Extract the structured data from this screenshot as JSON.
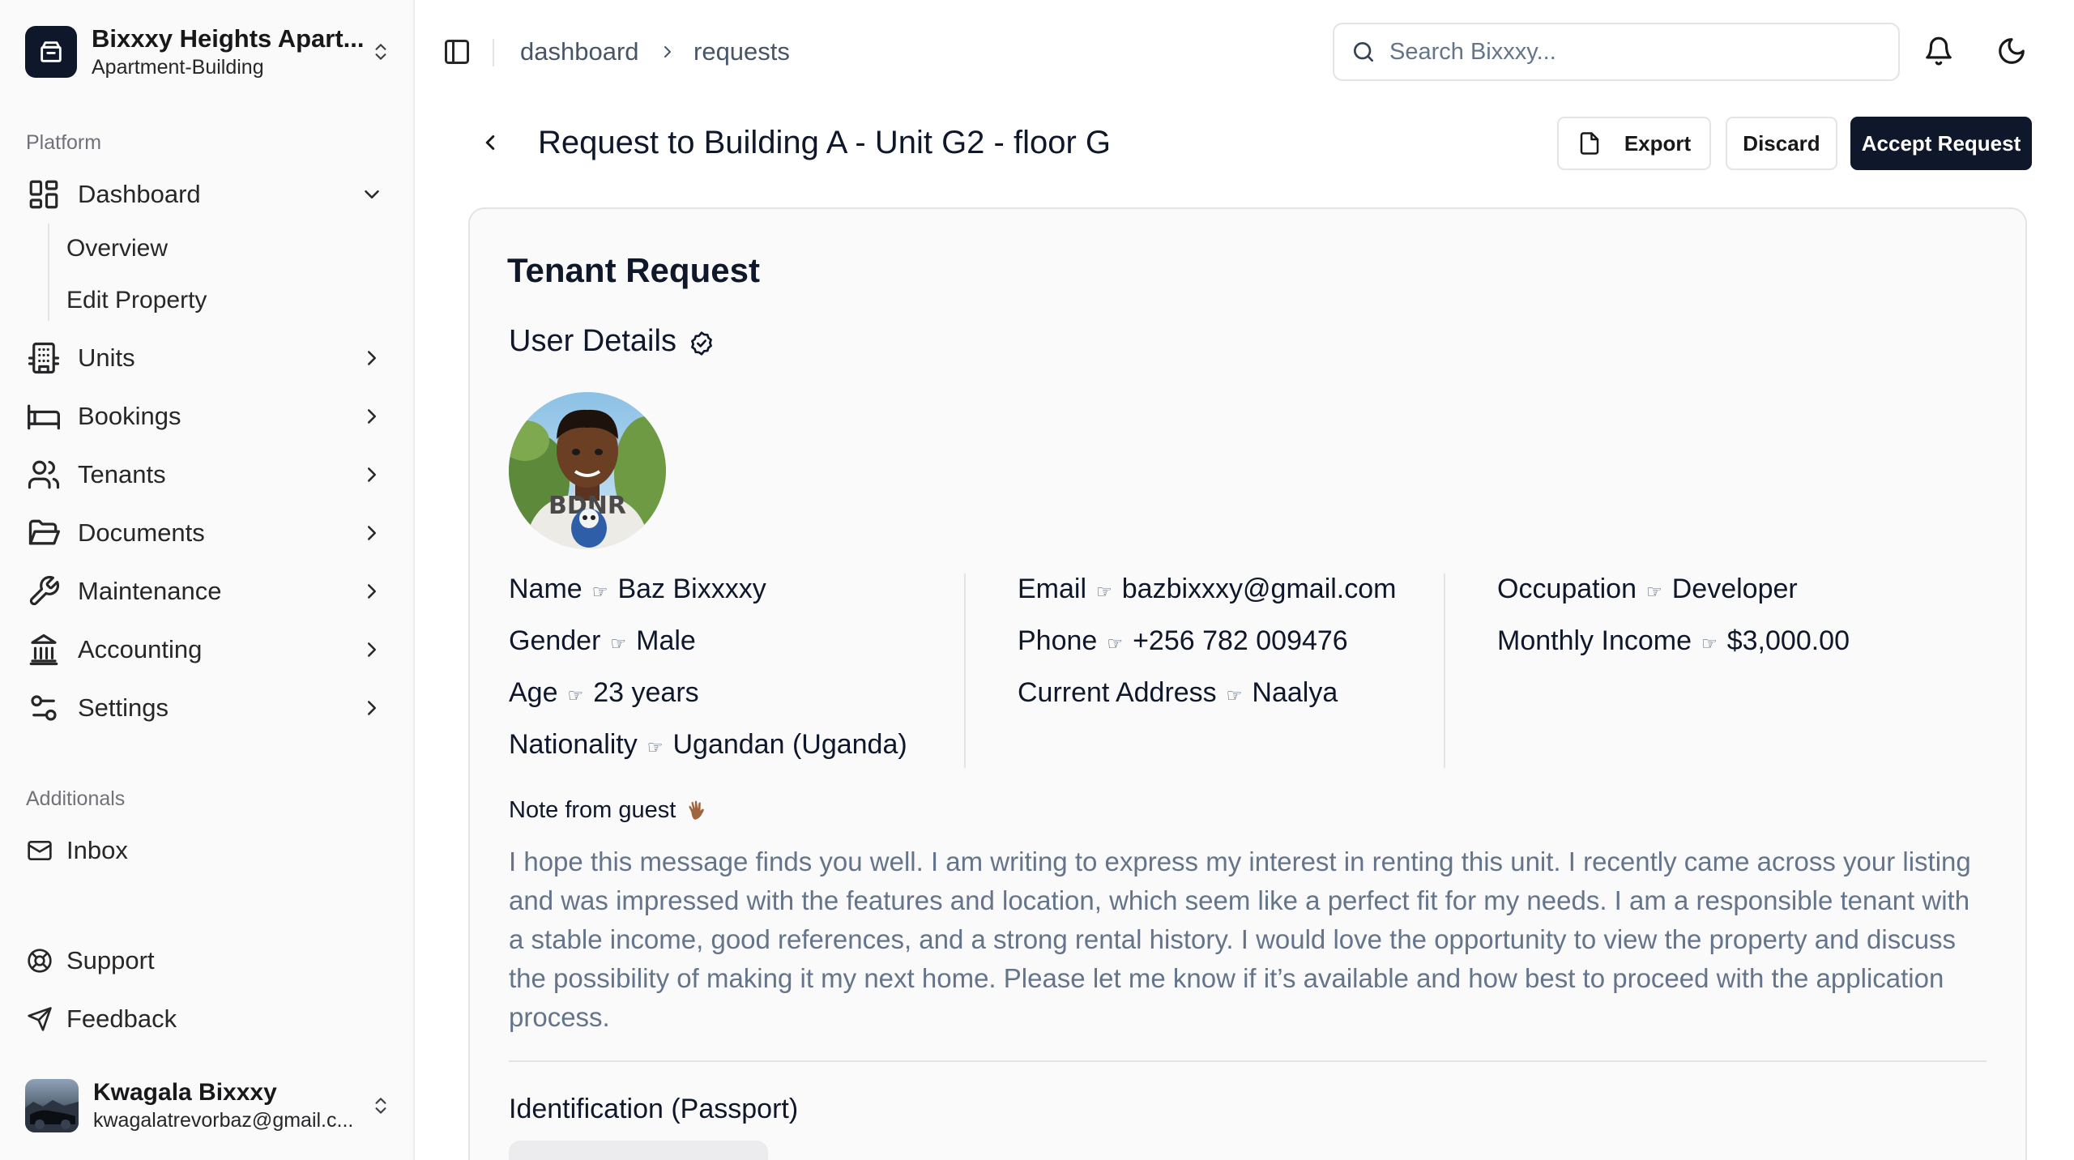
{
  "org": {
    "name": "Bixxxy Heights Apart...",
    "type": "Apartment-Building"
  },
  "sidebar": {
    "platform_label": "Platform",
    "dashboard": {
      "label": "Dashboard",
      "sub_items": [
        {
          "label": "Overview"
        },
        {
          "label": "Edit Property"
        }
      ]
    },
    "items": [
      {
        "label": "Units",
        "icon": "building-icon"
      },
      {
        "label": "Bookings",
        "icon": "bed-icon"
      },
      {
        "label": "Tenants",
        "icon": "users-icon"
      },
      {
        "label": "Documents",
        "icon": "folder-icon"
      },
      {
        "label": "Maintenance",
        "icon": "wrench-icon"
      },
      {
        "label": "Accounting",
        "icon": "bank-icon"
      },
      {
        "label": "Settings",
        "icon": "settings-icon"
      }
    ],
    "additionals_label": "Additionals",
    "inbox_label": "Inbox",
    "support_label": "Support",
    "feedback_label": "Feedback"
  },
  "user": {
    "name": "Kwagala Bixxxy",
    "email": "kwagalatrevorbaz@gmail.c..."
  },
  "breadcrumb": {
    "first": "dashboard",
    "second": "requests"
  },
  "search": {
    "placeholder": "Search Bixxxy..."
  },
  "page": {
    "title": "Request to Building A - Unit G2 - floor G",
    "export_label": "Export",
    "discard_label": "Discard",
    "accept_label": "Accept Request"
  },
  "card": {
    "title": "Tenant Request",
    "user_details_title": "User Details",
    "hand_glyph": "☞",
    "col1": [
      {
        "key": "Name",
        "value": "Baz Bixxxxy"
      },
      {
        "key": "Gender",
        "value": "Male"
      },
      {
        "key": "Age",
        "value": "23 years"
      },
      {
        "key": "Nationality",
        "value": "Ugandan (Uganda)"
      }
    ],
    "col2": [
      {
        "key": "Email",
        "value": "bazbixxxy@gmail.com"
      },
      {
        "key": "Phone",
        "value": "+256 782 009476"
      },
      {
        "key": "Current Address",
        "value": "Naalya"
      }
    ],
    "col3": [
      {
        "key": "Occupation",
        "value": "Developer"
      },
      {
        "key": "Monthly Income",
        "value": "$3,000.00"
      }
    ],
    "note_label": "Note from guest",
    "note_text": "I hope this message finds you well. I am writing to express my interest in renting this unit. I recently came across your listing and was impressed with the features and location, which seem like a perfect fit for my needs. I am a responsible tenant with a stable income, good references, and a strong rental history. I would love the opportunity to view the property and discuss the possibility of making it my next home. Please let me know if it’s available and how best to proceed with the application process.",
    "identification_title": "Identification (Passport)",
    "shirt_text": "BDNR"
  },
  "colors": {
    "primary": "#0f172a",
    "muted_text": "#64748b",
    "border": "#e4e4e7",
    "sidebar_bg": "#fafafa"
  }
}
